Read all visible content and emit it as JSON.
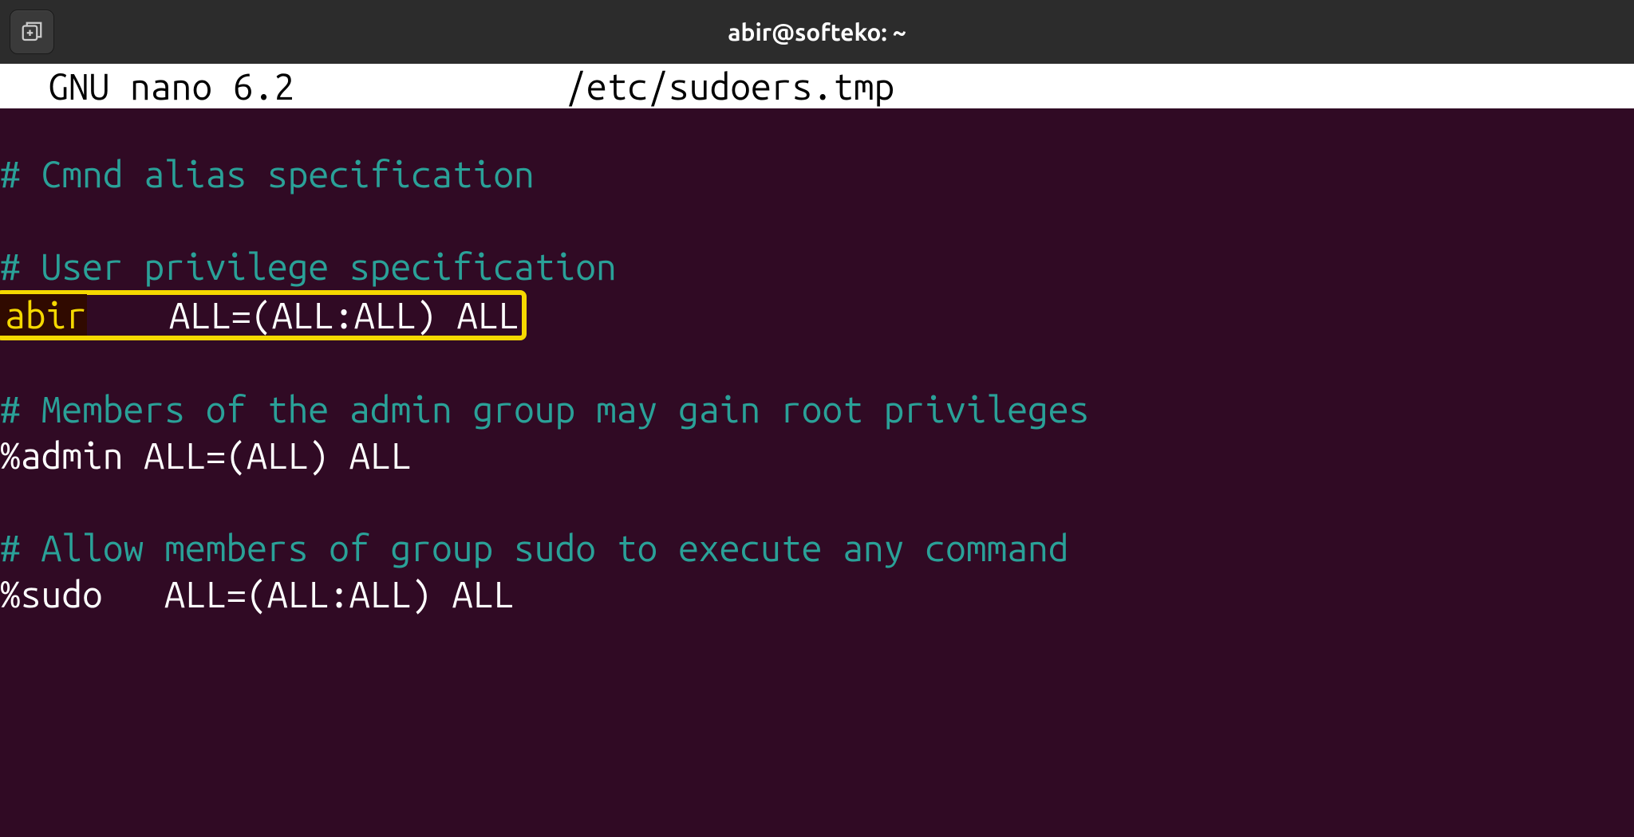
{
  "titlebar": {
    "title": "abir@softeko: ~"
  },
  "nano": {
    "app_name": "GNU nano 6.2",
    "filename": "/etc/sudoers.tmp"
  },
  "editor": {
    "lines": [
      {
        "type": "comment",
        "text": "# Cmnd alias specification"
      },
      {
        "type": "blank",
        "text": ""
      },
      {
        "type": "comment",
        "text": "# User privilege specification"
      },
      {
        "type": "highlighted",
        "user": "abir",
        "rule": "    ALL=(ALL:ALL) ALL"
      },
      {
        "type": "blank",
        "text": ""
      },
      {
        "type": "comment",
        "text": "# Members of the admin group may gain root privileges"
      },
      {
        "type": "white",
        "text": "%admin ALL=(ALL) ALL"
      },
      {
        "type": "blank",
        "text": ""
      },
      {
        "type": "comment",
        "text": "# Allow members of group sudo to execute any command"
      },
      {
        "type": "white",
        "text": "%sudo   ALL=(ALL:ALL) ALL"
      }
    ]
  }
}
